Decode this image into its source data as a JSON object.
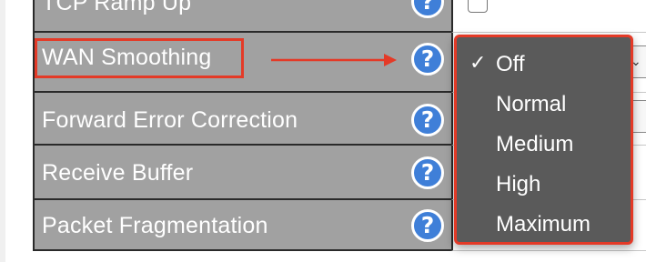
{
  "settings": {
    "rows": [
      {
        "label": "TCP Ramp Up",
        "help": "?"
      },
      {
        "label": "WAN Smoothing",
        "help": "?"
      },
      {
        "label": "Forward Error Correction",
        "help": "?"
      },
      {
        "label": "Receive Buffer",
        "help": "?"
      },
      {
        "label": "Packet Fragmentation",
        "help": "?"
      }
    ]
  },
  "dropdown": {
    "selected": "Off",
    "check_glyph": "✓",
    "options": [
      "Off",
      "Normal",
      "Medium",
      "High",
      "Maximum"
    ]
  },
  "colors": {
    "label_bg": "#a1a1a1",
    "highlight": "#e43a27",
    "help_icon": "#3f7fd8",
    "menu_bg": "#5a5a5a"
  },
  "icons": {
    "help": "question-circle-icon",
    "arrow": "right-arrow-icon",
    "checkmark": "checkmark-icon",
    "chevron": "chevron-down-icon"
  }
}
